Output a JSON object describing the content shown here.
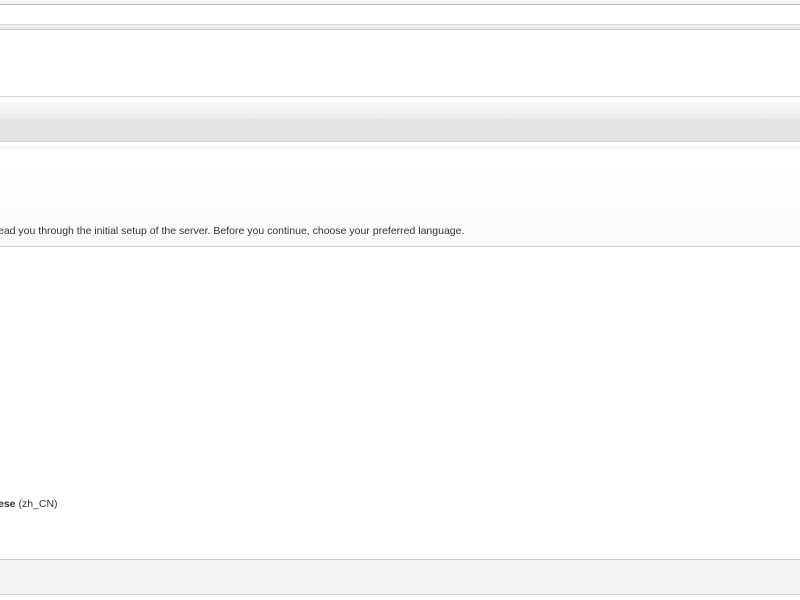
{
  "intro": {
    "text": "ead you through the initial setup of the server. Before you continue, choose your preferred language."
  },
  "languages": {
    "items": [
      {
        "name": "ese",
        "code": "(zh_CN)",
        "selected": false
      }
    ]
  }
}
